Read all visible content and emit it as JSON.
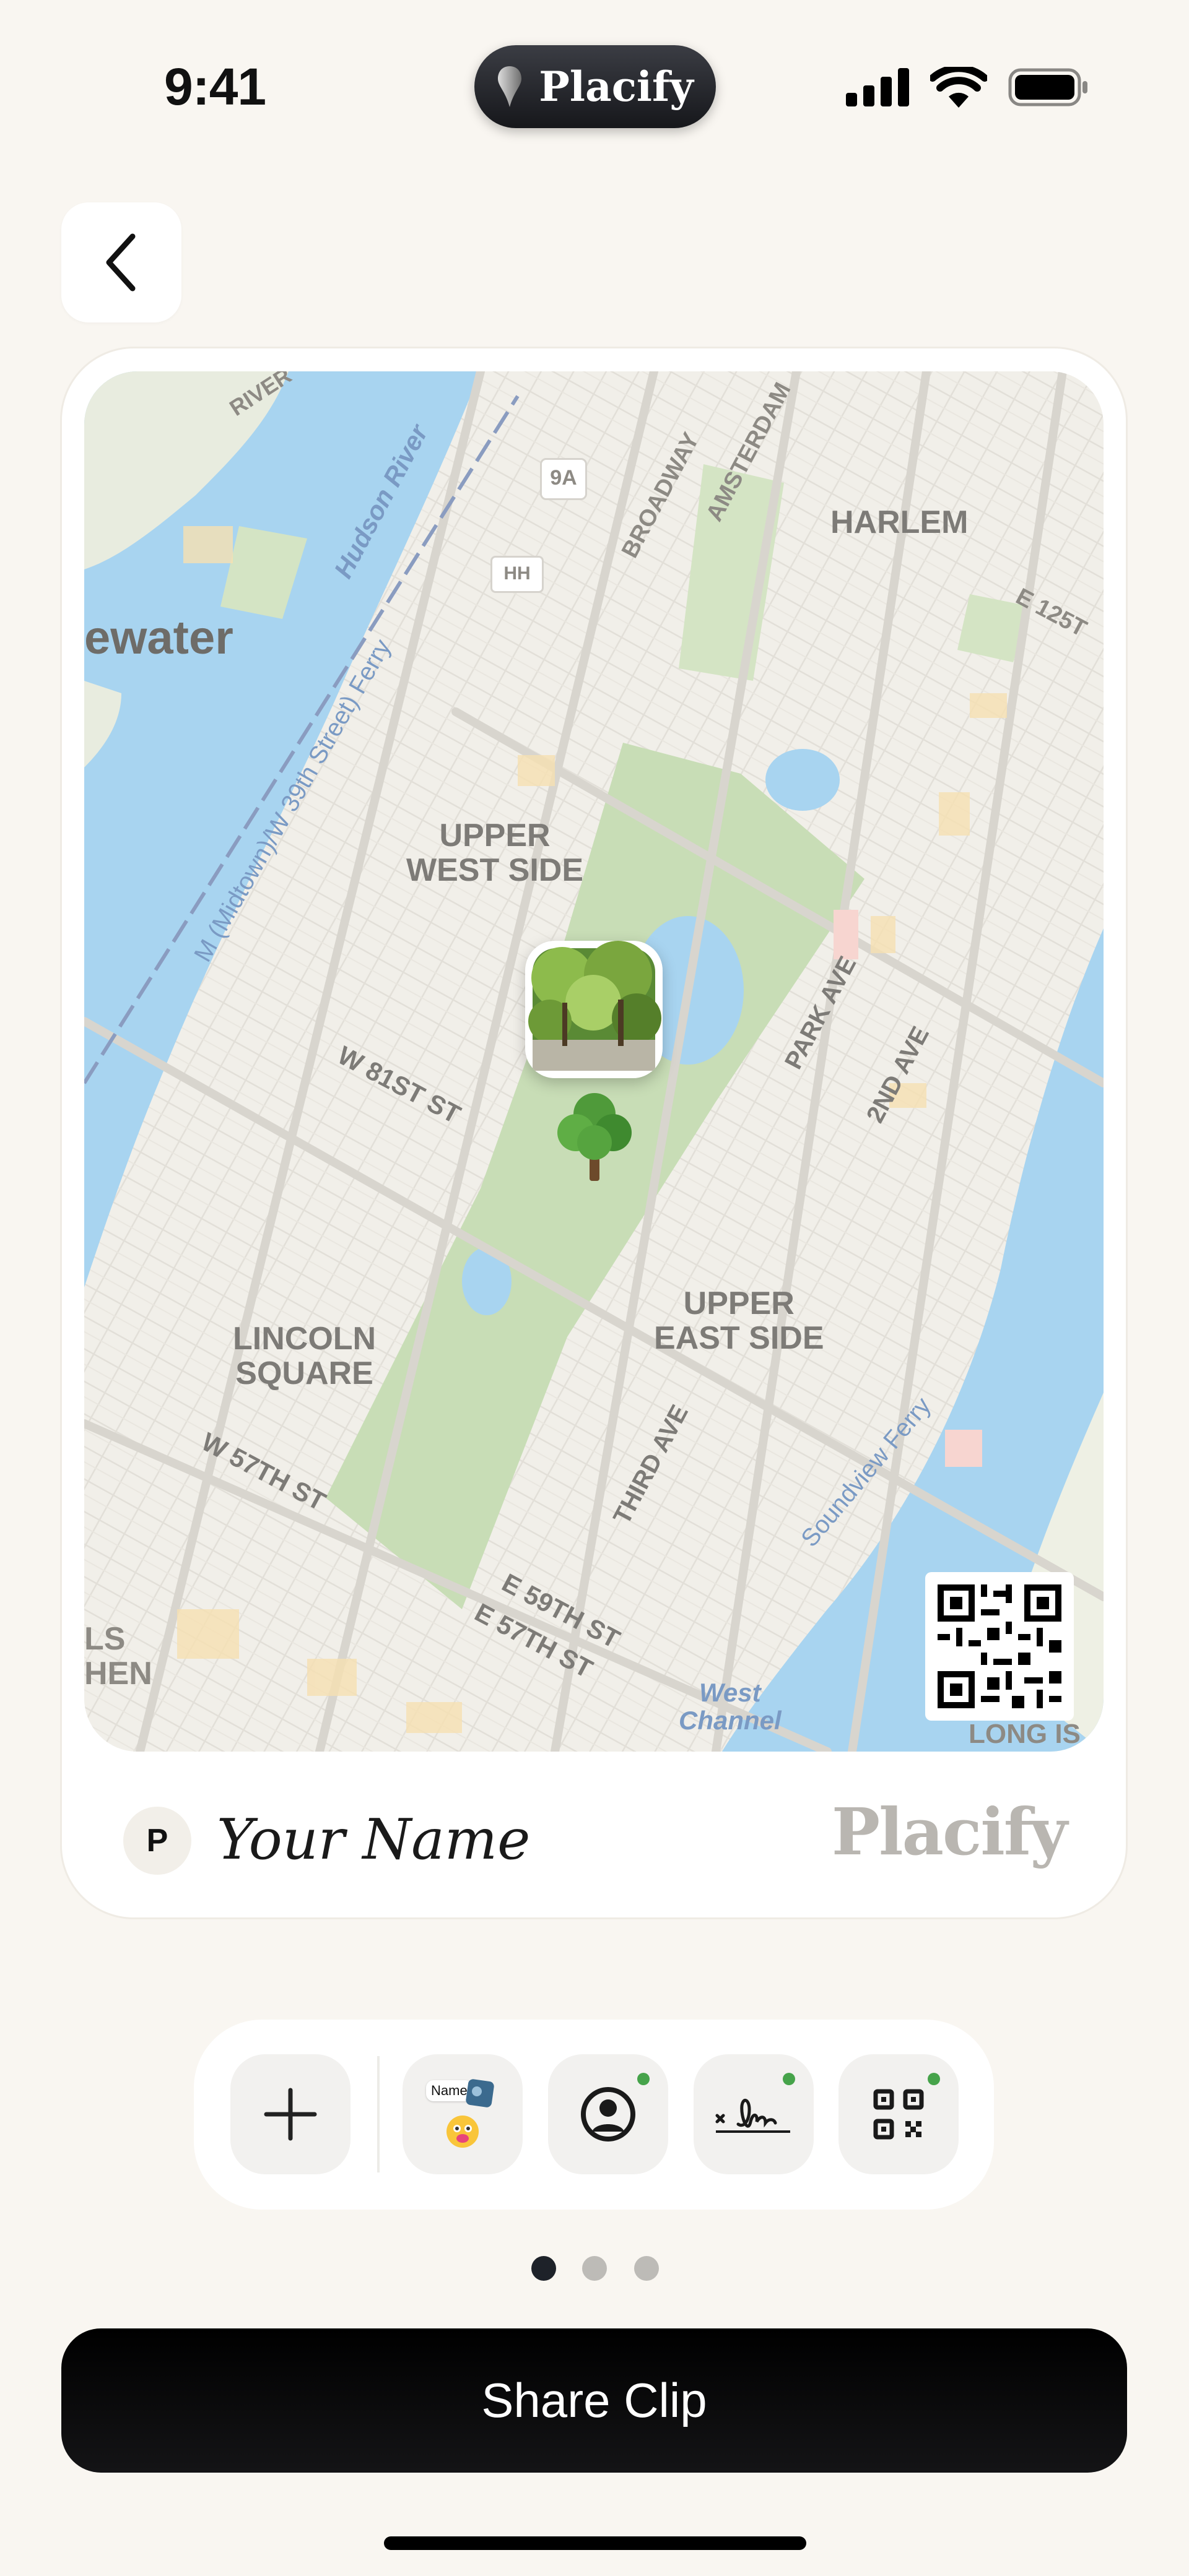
{
  "status_bar": {
    "time": "9:41",
    "app_pill_label": "Placify",
    "icons": [
      "signal-icon",
      "wifi-icon",
      "battery-icon"
    ]
  },
  "header": {
    "back_icon": "chevron-left-icon"
  },
  "map_card": {
    "map_labels": {
      "river_top": "RIVER",
      "edgewater": "ewater",
      "hudson_river": "Hudson River",
      "ferry": "M (Midtown)/W 39th Street) Ferry",
      "route_9a": "9A",
      "route_hh": "HH",
      "broadway": "BROADWAY",
      "amsterdam": "AMSTERDAM",
      "harlem": "HARLEM",
      "e125": "E 125T",
      "upper_west_side": "UPPER\nWEST SIDE",
      "w81": "W 81ST ST",
      "park_ave": "PARK AVE",
      "second_ave": "2ND AVE",
      "upper_east_side": "UPPER\nEAST SIDE",
      "lincoln_square": "LINCOLN\nSQUARE",
      "w57": "W 57TH ST",
      "third_ave": "THIRD AVE",
      "e59": "E 59TH ST",
      "e57": "E 57TH ST",
      "soundview_ferry": "Soundview Ferry",
      "west_channel": "West\nChannel",
      "long_is": "LONG IS",
      "ls_hen": "LS\nHEN"
    },
    "pin_icons": [
      "tree-photo",
      "deciduous-tree-emoji"
    ],
    "avatar_initial": "P",
    "name": "Your Name",
    "brand": "Placify"
  },
  "toolbar": {
    "tools": [
      {
        "icon": "plus-icon"
      },
      {
        "icon": "name-sticker-icon",
        "sticker_label": "Name"
      },
      {
        "icon": "profile-icon"
      },
      {
        "icon": "signature-icon"
      },
      {
        "icon": "qr-code-icon"
      }
    ]
  },
  "pager": {
    "count": 3,
    "active": 0
  },
  "share_button": {
    "label": "Share Clip"
  },
  "colors": {
    "background": "#f9f6f1",
    "water": "#a8d4f0",
    "park": "#c8ddb6",
    "active_dot": "#46a34a",
    "primary": "#000000"
  }
}
